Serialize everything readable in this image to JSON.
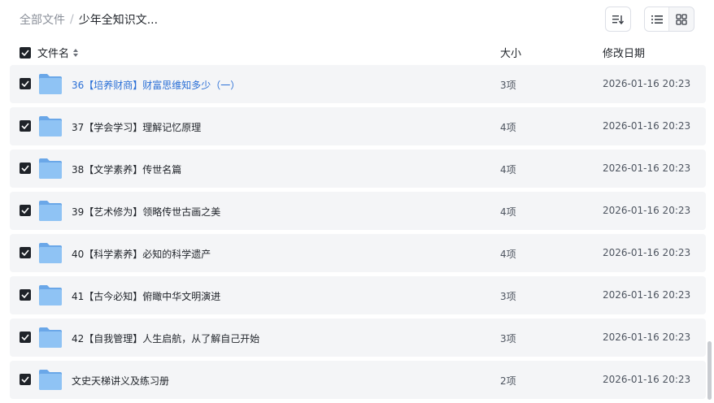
{
  "breadcrumb": {
    "root": "全部文件",
    "separator": "/",
    "current": "少年全知识文..."
  },
  "columns": {
    "name": "文件名",
    "size": "大小",
    "date": "修改日期"
  },
  "rows": [
    {
      "name": "36【培养财商】财富思维知多少（一）",
      "size": "3项",
      "date": "2026-01-16 20:23",
      "highlight": true
    },
    {
      "name": "37【学会学习】理解记忆原理",
      "size": "4项",
      "date": "2026-01-16 20:23"
    },
    {
      "name": "38【文学素养】传世名篇",
      "size": "4项",
      "date": "2026-01-16 20:23"
    },
    {
      "name": "39【艺术修为】领略传世古画之美",
      "size": "4项",
      "date": "2026-01-16 20:23"
    },
    {
      "name": "40【科学素养】必知的科学遗产",
      "size": "4项",
      "date": "2026-01-16 20:23"
    },
    {
      "name": "41【古今必知】俯瞰中华文明演进",
      "size": "3项",
      "date": "2026-01-16 20:23"
    },
    {
      "name": "42【自我管理】人生启航，从了解自己开始",
      "size": "3项",
      "date": "2026-01-16 20:23"
    },
    {
      "name": "文史天梯讲义及练习册",
      "size": "2项",
      "date": "2026-01-16 20:23"
    }
  ],
  "icons": {
    "sort": "sort-list-icon",
    "list_view": "list-view-icon",
    "grid_view": "grid-view-icon",
    "folder": "folder-icon",
    "checkbox": "checked-checkbox-icon"
  },
  "colors": {
    "link": "#2a6fd6",
    "row_bg": "#f4f5f7",
    "folder": "#7fb6ef",
    "checkbox": "#1f2329"
  }
}
